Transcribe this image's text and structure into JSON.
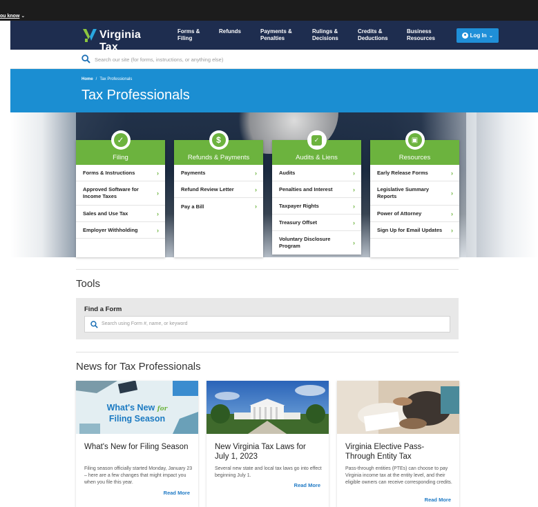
{
  "topbar": {
    "did_you_know": "ou know"
  },
  "nav": {
    "brand": "Virginia Tax",
    "links": [
      [
        "Forms &",
        "Filing"
      ],
      [
        "Refunds",
        ""
      ],
      [
        "Payments &",
        "Penalties"
      ],
      [
        "Rulings &",
        "Decisions"
      ],
      [
        "Credits &",
        "Deductions"
      ],
      [
        "Business",
        "Resources"
      ]
    ],
    "login": "Log In"
  },
  "search": {
    "placeholder": "Search our site (for forms, instructions, or anything else)"
  },
  "breadcrumb": {
    "home": "Home",
    "sep": "/",
    "current": "Tax Professionals"
  },
  "page_title": "Tax Professionals",
  "cards": [
    {
      "title": "Filing",
      "icon": "check-icon",
      "items": [
        "Forms & Instructions",
        "Approved Software for Income Taxes",
        "Sales and Use Tax",
        "Employer Withholding"
      ]
    },
    {
      "title": "Refunds & Payments",
      "icon": "dollar-icon",
      "items": [
        "Payments",
        "Refund Review Letter",
        "Pay a Bill"
      ]
    },
    {
      "title": "Audits & Liens",
      "icon": "document-check-icon",
      "items": [
        "Audits",
        "Penalties and Interest",
        "Taxpayer Rights",
        "Treasury Offset",
        "Voluntary Disclosure Program"
      ]
    },
    {
      "title": "Resources",
      "icon": "book-icon",
      "items": [
        "Early Release Forms",
        "Legislative Summary Reports",
        "Power of Attorney",
        "Sign Up for Email Updates"
      ]
    }
  ],
  "tools": {
    "heading": "Tools",
    "find_form_label": "Find a Form",
    "find_form_placeholder": "Search using Form #, name, or keyword"
  },
  "news": {
    "heading": "News for Tax Professionals",
    "items": [
      {
        "image_text_1": "What's New",
        "image_text_2": "for",
        "image_text_3": "Filing Season",
        "title": "What's New for Filing Season",
        "body": "Filing season officially started Monday, January 23 – here are a few changes that might impact you when you file this year.",
        "read_more": "Read More"
      },
      {
        "title": "New Virginia Tax Laws for July 1, 2023",
        "body": "Several new state and local tax laws go into effect beginning July 1.",
        "read_more": "Read More"
      },
      {
        "title": "Virginia Elective Pass-Through Entity Tax",
        "body": "Pass-through entities (PTEs) can choose to pay Virginia income tax at the entity level, and their eligible owners can receive corresponding credits.",
        "read_more": "Read More"
      }
    ]
  },
  "colors": {
    "navy": "#1e2d4f",
    "blue": "#1b8ed2",
    "green": "#6cb33e",
    "link": "#1f7ac5"
  }
}
